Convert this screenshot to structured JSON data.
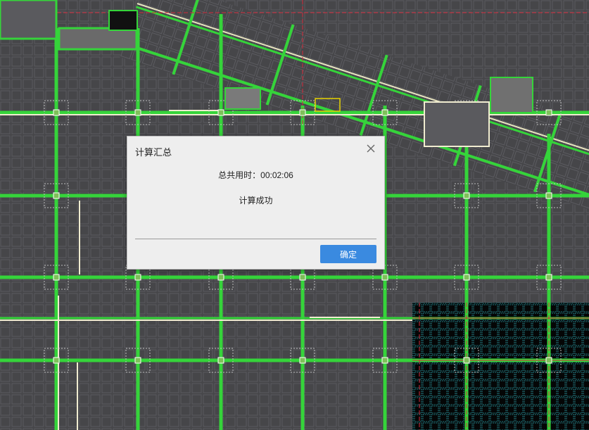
{
  "dialog": {
    "title": "计算汇总",
    "total_time_label": "总共用时：",
    "total_time_value": "00:02:06",
    "status": "计算成功",
    "ok_label": "确定"
  },
  "icons": {
    "close": "close-icon"
  },
  "colors": {
    "background": "#47474a",
    "beam_green": "#35d43a",
    "axis_red": "#d42a3a",
    "accent_blue": "#3a8ae0"
  }
}
